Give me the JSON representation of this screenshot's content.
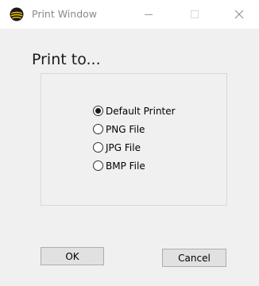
{
  "window": {
    "title": "Print Window",
    "icon": "print-app-icon",
    "controls": {
      "minimize_icon": "minimize-icon",
      "maximize_icon": "maximize-icon",
      "close_icon": "close-icon"
    }
  },
  "dialog": {
    "heading": "Print to...",
    "options": [
      {
        "label": "Default Printer",
        "selected": true
      },
      {
        "label": "PNG File",
        "selected": false
      },
      {
        "label": "JPG File",
        "selected": false
      },
      {
        "label": "BMP File",
        "selected": false
      }
    ],
    "ok_label": "OK",
    "cancel_label": "Cancel"
  },
  "colors": {
    "titlebar_bg": "#ffffff",
    "window_bg": "#f0f0f0",
    "button_bg": "#e1e1e1",
    "button_border": "#adadad",
    "icon_yellow": "#f2c200"
  }
}
